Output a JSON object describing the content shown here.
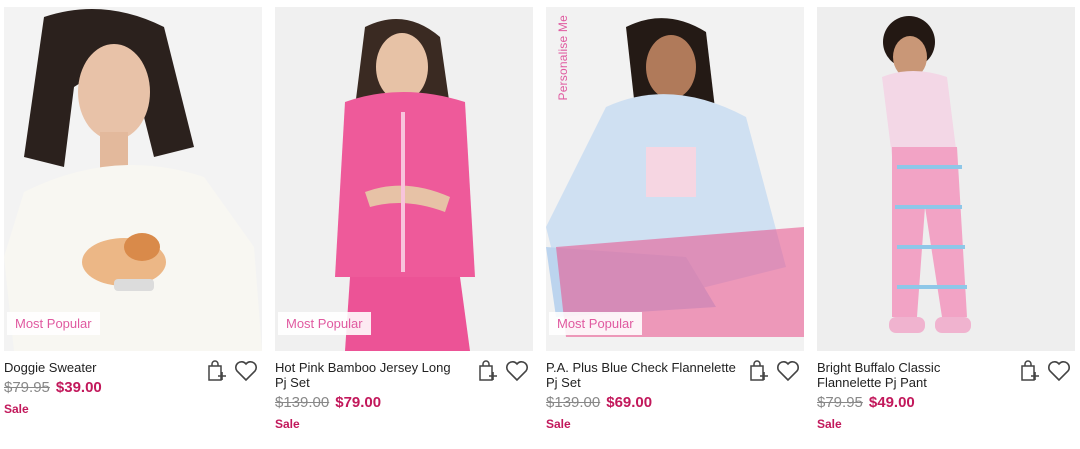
{
  "products": [
    {
      "name": "Doggie Sweater",
      "old_price": "$79.95",
      "price": "$39.00",
      "sale": "Sale",
      "badge": "Most Popular",
      "personalise": ""
    },
    {
      "name": "Hot Pink Bamboo Jersey Long Pj Set",
      "old_price": "$139.00",
      "price": "$79.00",
      "sale": "Sale",
      "badge": "Most Popular",
      "personalise": ""
    },
    {
      "name": "P.A. Plus Blue Check Flannelette Pj Set",
      "old_price": "$139.00",
      "price": "$69.00",
      "sale": "Sale",
      "badge": "Most Popular",
      "personalise": "Personalise Me"
    },
    {
      "name": "Bright Buffalo Classic Flannelette Pj Pant",
      "old_price": "$79.95",
      "price": "$49.00",
      "sale": "Sale",
      "badge": "",
      "personalise": ""
    }
  ],
  "icons": {
    "bag": "add-to-bag-icon",
    "wish": "heart-icon"
  },
  "colors": {
    "accent": "#c2185b",
    "badge_text": "#e05aa0"
  }
}
